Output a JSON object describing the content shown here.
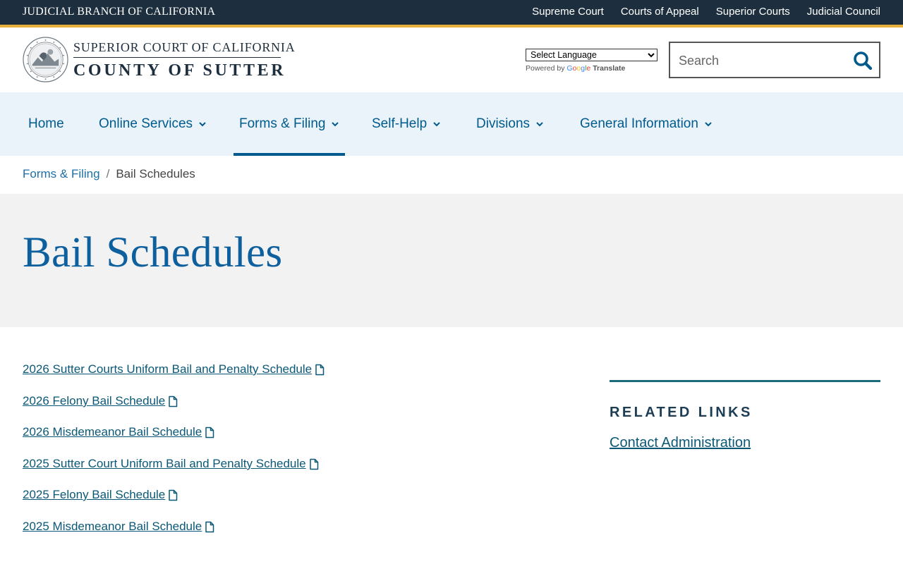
{
  "topbar": {
    "branch": "JUDICIAL BRANCH OF CALIFORNIA",
    "links": [
      "Supreme Court",
      "Courts of Appeal",
      "Superior Courts",
      "Judicial Council"
    ]
  },
  "header": {
    "court_line1": "SUPERIOR COURT OF CALIFORNIA",
    "court_line2": "COUNTY OF SUTTER",
    "translate": {
      "select_label": "Select Language",
      "powered_by": "Powered by",
      "google": [
        "G",
        "o",
        "o",
        "g",
        "l",
        "e"
      ],
      "translate_word": "Translate"
    },
    "search": {
      "placeholder": "Search"
    }
  },
  "nav": {
    "home": "Home",
    "online_services": "Online Services",
    "forms_filing": "Forms & Filing",
    "self_help": "Self-Help",
    "divisions": "Divisions",
    "general_information": "General Information",
    "active": "Forms & Filing"
  },
  "breadcrumb": {
    "parent": "Forms & Filing",
    "separator": "/",
    "current": "Bail Schedules"
  },
  "page": {
    "title": "Bail Schedules"
  },
  "documents": [
    "2026 Sutter Courts Uniform Bail and Penalty Schedule",
    "2026 Felony Bail Schedule",
    "2026 Misdemeanor Bail Schedule",
    "2025 Sutter Court Uniform Bail and Penalty Schedule",
    "2025 Felony Bail Schedule",
    "2025 Misdemeanor Bail Schedule"
  ],
  "related": {
    "heading": "RELATED LINKS",
    "links": [
      "Contact Administration"
    ]
  },
  "colors": {
    "topbar_bg": "#1d2f3e",
    "topbar_accent": "#e6b03a",
    "nav_bg": "#eaf3fa",
    "link": "#005a8c",
    "title": "#0d5f9e",
    "hero_bg": "#f2f2f2"
  },
  "icons": {
    "search": "search-icon",
    "chevron": "chevron-down-icon",
    "document": "file-icon",
    "seal": "court-seal-logo"
  }
}
